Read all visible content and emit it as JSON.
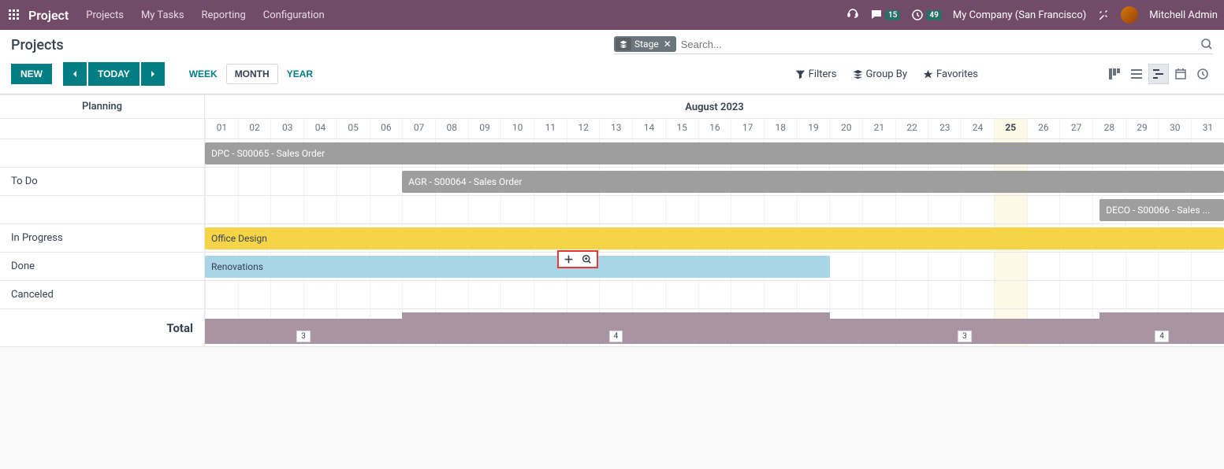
{
  "topbar": {
    "brand": "Project",
    "menu": [
      "Projects",
      "My Tasks",
      "Reporting",
      "Configuration"
    ],
    "msg_count": "15",
    "activity_count": "49",
    "company": "My Company (San Francisco)",
    "user": "Mitchell Admin"
  },
  "page": {
    "title": "Projects",
    "new_btn": "NEW",
    "today_btn": "TODAY",
    "scales": {
      "week": "WEEK",
      "month": "MONTH",
      "year": "YEAR"
    },
    "facet_label": "Stage",
    "search_placeholder": "Search...",
    "filters": "Filters",
    "groupby": "Group By",
    "favorites": "Favorites"
  },
  "gantt": {
    "side_header": "Planning",
    "month": "August 2023",
    "days": [
      "01",
      "02",
      "03",
      "04",
      "05",
      "06",
      "07",
      "08",
      "09",
      "10",
      "11",
      "12",
      "13",
      "14",
      "15",
      "16",
      "17",
      "18",
      "19",
      "20",
      "21",
      "22",
      "23",
      "24",
      "25",
      "26",
      "27",
      "28",
      "29",
      "30",
      "31"
    ],
    "today_idx": 24,
    "stages": {
      "todo": "To Do",
      "inprogress": "In Progress",
      "done": "Done",
      "canceled": "Canceled"
    },
    "tasks": {
      "dpc": "DPC - S00065 - Sales Order",
      "agr": "AGR - S00064 - Sales Order",
      "deco": "DECO - S00066 - Sales ...",
      "office": "Office Design",
      "reno": "Renovations"
    },
    "total_label": "Total",
    "totals": [
      "3",
      "4",
      "3",
      "4"
    ]
  }
}
